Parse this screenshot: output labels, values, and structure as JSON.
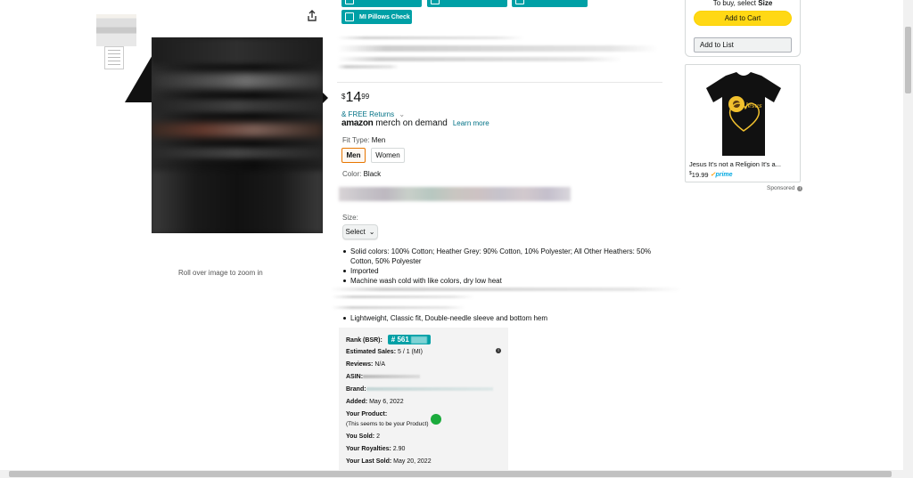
{
  "product": {
    "zoom_hint": "Roll over image to zoom in",
    "price_symbol": "$",
    "price_whole": "14",
    "price_fraction": "99",
    "returns_link": "& FREE Returns",
    "returns_chevron": "⌄",
    "merch_brand": "amazon",
    "merch_suffix": "merch on demand",
    "learn_more": "Learn more",
    "fit_type_label": "Fit Type:",
    "fit_type_value": "Men",
    "fit_options": [
      "Men",
      "Women"
    ],
    "color_label": "Color:",
    "color_value": "Black",
    "size_label": "Size:",
    "size_select": "Select",
    "size_chevron": "⌄",
    "bullets": [
      "Solid colors: 100% Cotton; Heather Grey: 90% Cotton, 10% Polyester; All Other Heathers: 50% Cotton, 50% Polyester",
      "Imported",
      "Machine wash cold with like colors, dry low heat"
    ],
    "bullet_extra": "Lightweight, Classic fit, Double-needle sleeve and bottom hem"
  },
  "toolbar": {
    "pillows_check": "MI Pillows Check"
  },
  "extension": {
    "rank_label": "Rank (BSR):",
    "rank_value": "# 561",
    "estimated_sales_label": "Estimated Sales:",
    "estimated_sales_value": "5 / 1 (MI)",
    "reviews_label": "Reviews:",
    "reviews_value": "N/A",
    "asin_label": "ASIN:",
    "brand_label": "Brand:",
    "added_label": "Added:",
    "added_value": "May 6, 2022",
    "your_product_label": "Your Product:",
    "your_product_note": "(This seems to be your Product)",
    "you_sold_label": "You Sold:",
    "you_sold_value": "2",
    "royalties_label": "Your Royalties:",
    "royalties_value": "2.90",
    "last_sold_label": "Your Last Sold:",
    "last_sold_value": "May 20, 2022",
    "info_glyph": "i"
  },
  "buybox": {
    "note_prefix": "To buy, select",
    "note_bold": "Size",
    "add_to_cart": "Add to Cart",
    "add_to_list": "Add to List"
  },
  "ad": {
    "title": "Jesus It's not a Religion It's a...",
    "price_symbol": "$",
    "price": "19.99",
    "prime": "prime",
    "check": "✓",
    "sponsored": "Sponsored",
    "sponsored_info": "i"
  },
  "colors": {
    "teal": "#00a0a6",
    "link": "#007185",
    "cart_yellow": "#ffd814",
    "selected_orange": "#e77600",
    "green_status": "#1bab3c"
  },
  "icons": [
    "share-icon",
    "chevron-down-icon",
    "info-icon",
    "green-status-dot"
  ]
}
